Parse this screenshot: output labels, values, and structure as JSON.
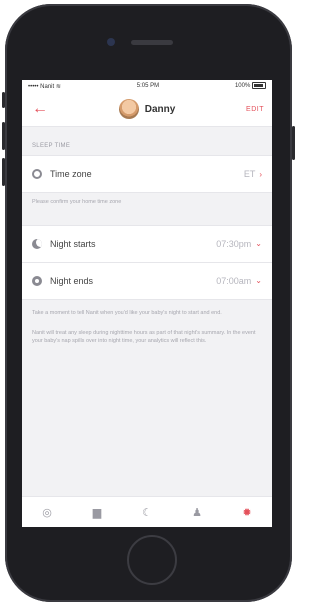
{
  "status_bar": {
    "carrier": "••••• Nanit",
    "wifi_icon": "wifi-icon",
    "time": "5:05 PM",
    "battery": "100%"
  },
  "navbar": {
    "back_icon": "back-arrow-icon",
    "title": "Danny",
    "edit_label": "EDIT"
  },
  "section_title": "SLEEP TIME",
  "timezone": {
    "label": "Time zone",
    "value": "ET",
    "help": "Please confirm your home time zone"
  },
  "night_starts": {
    "label": "Night starts",
    "value": "07:30pm"
  },
  "night_ends": {
    "label": "Night ends",
    "value": "07:00am"
  },
  "help_1": "Take a moment to tell Nanit when you'd like your baby's night to start and end.",
  "help_2": "Nanit will treat any sleep during nighttime hours as part of that night's summary. In the event your baby's nap spills over into night time, your analytics will reflect this.",
  "tabbar": {
    "items": [
      "camera-icon",
      "suitcase-icon",
      "moon-icon",
      "bell-icon",
      "settings-gear-icon"
    ],
    "active": "settings-gear-icon"
  },
  "colors": {
    "accent": "#e4505a",
    "background": "#f2f2f4"
  }
}
